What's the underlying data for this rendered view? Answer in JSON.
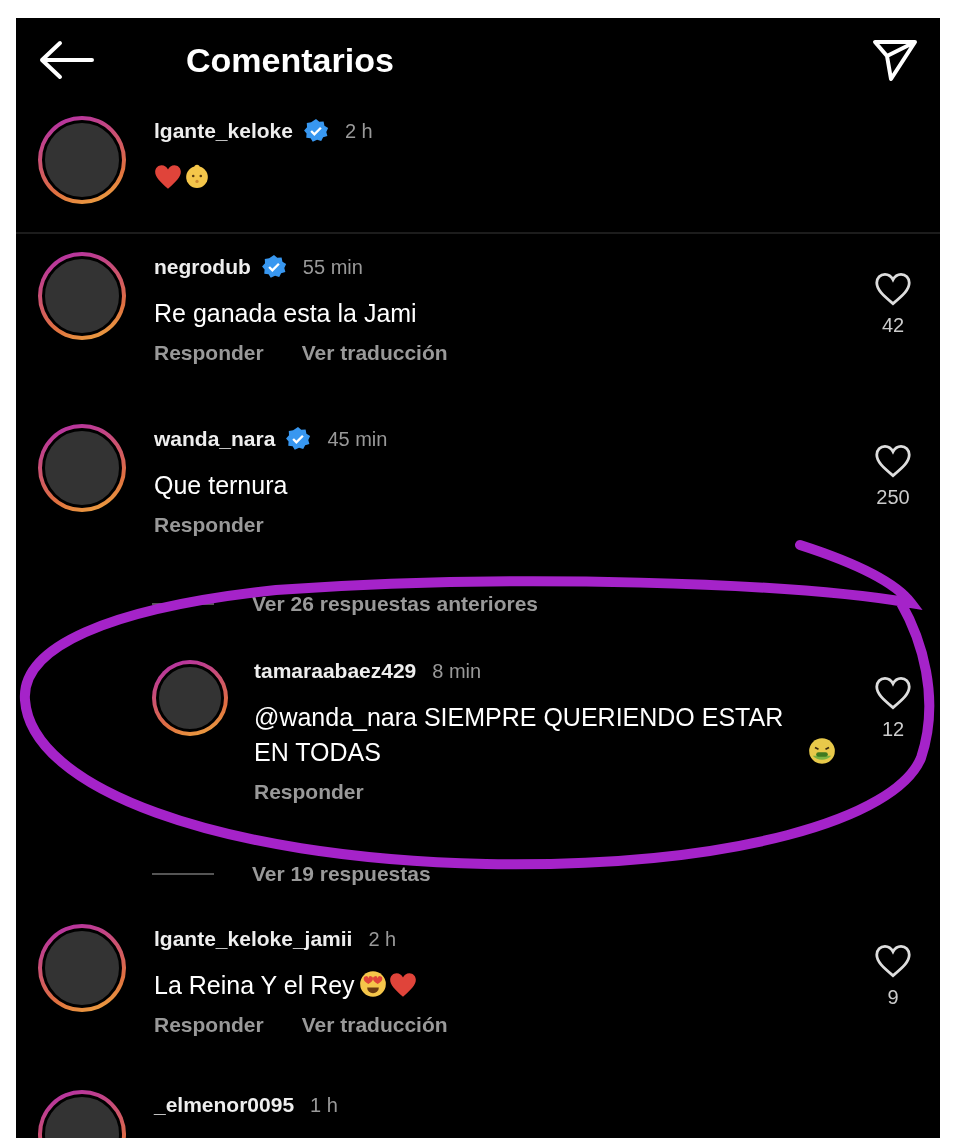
{
  "header": {
    "title": "Comentarios"
  },
  "items": [
    {
      "kind": "caption",
      "username": "lgante_keloke",
      "verified": true,
      "time": "2 h",
      "emojis": [
        {
          "kind": "heart"
        },
        {
          "kind": "baby"
        }
      ]
    },
    {
      "kind": "comment",
      "username": "negrodub",
      "verified": true,
      "time": "55 min",
      "text": "Re ganada esta la Jami",
      "actions": [
        "Responder",
        "Ver traducción"
      ],
      "likes": "42"
    },
    {
      "kind": "comment",
      "username": "wanda_nara",
      "verified": true,
      "time": "45 min",
      "text": "Que ternura",
      "actions": [
        "Responder"
      ],
      "likes": "250"
    },
    {
      "kind": "replies_link",
      "label": "Ver 26 respuestas anteriores"
    },
    {
      "kind": "reply",
      "username": "tamaraabaez429",
      "verified": false,
      "time": "8 min",
      "text": "@wanda_nara SIEMPRE QUERIENDO ESTAR EN TODAS",
      "emojis": [
        {
          "kind": "sick"
        }
      ],
      "actions": [
        "Responder"
      ],
      "likes": "12"
    },
    {
      "kind": "replies_link",
      "label": "Ver 19 respuestas"
    },
    {
      "kind": "comment",
      "username": "lgante_keloke_jamii",
      "verified": false,
      "time": "2 h",
      "text": "La Reina Y el Rey",
      "emojis": [
        {
          "kind": "heart-eyes"
        },
        {
          "kind": "heart"
        }
      ],
      "actions": [
        "Responder",
        "Ver traducción"
      ],
      "likes": "9"
    },
    {
      "kind": "comment",
      "username": "_elmenor0095",
      "verified": false,
      "time": "1 h"
    }
  ]
}
